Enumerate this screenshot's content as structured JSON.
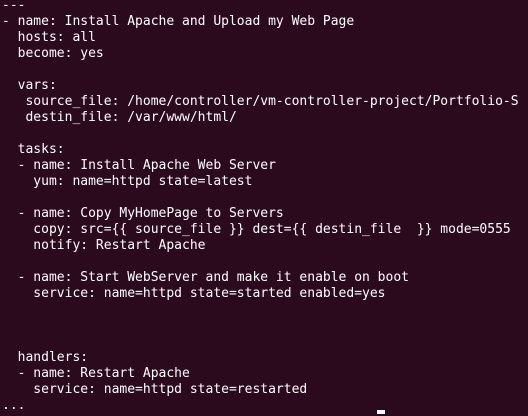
{
  "terminal": {
    "lines": [
      "---",
      "- name: Install Apache and Upload my Web Page",
      "  hosts: all",
      "  become: yes",
      "",
      "  vars:",
      "   source_file: /home/controller/vm-controller-project/Portfolio-S",
      "   destin_file: /var/www/html/",
      "",
      "  tasks:",
      "  - name: Install Apache Web Server",
      "    yum: name=httpd state=latest",
      "",
      "  - name: Copy MyHomePage to Servers",
      "    copy: src={{ source_file }} dest={{ destin_file  }} mode=0555",
      "    notify: Restart Apache",
      "",
      "  - name: Start WebServer and make it enable on boot",
      "    service: name=httpd state=started enabled=yes",
      "",
      "",
      "",
      "  handlers:",
      "  - name: Restart Apache",
      "    service: name=httpd state=restarted",
      "..."
    ]
  }
}
